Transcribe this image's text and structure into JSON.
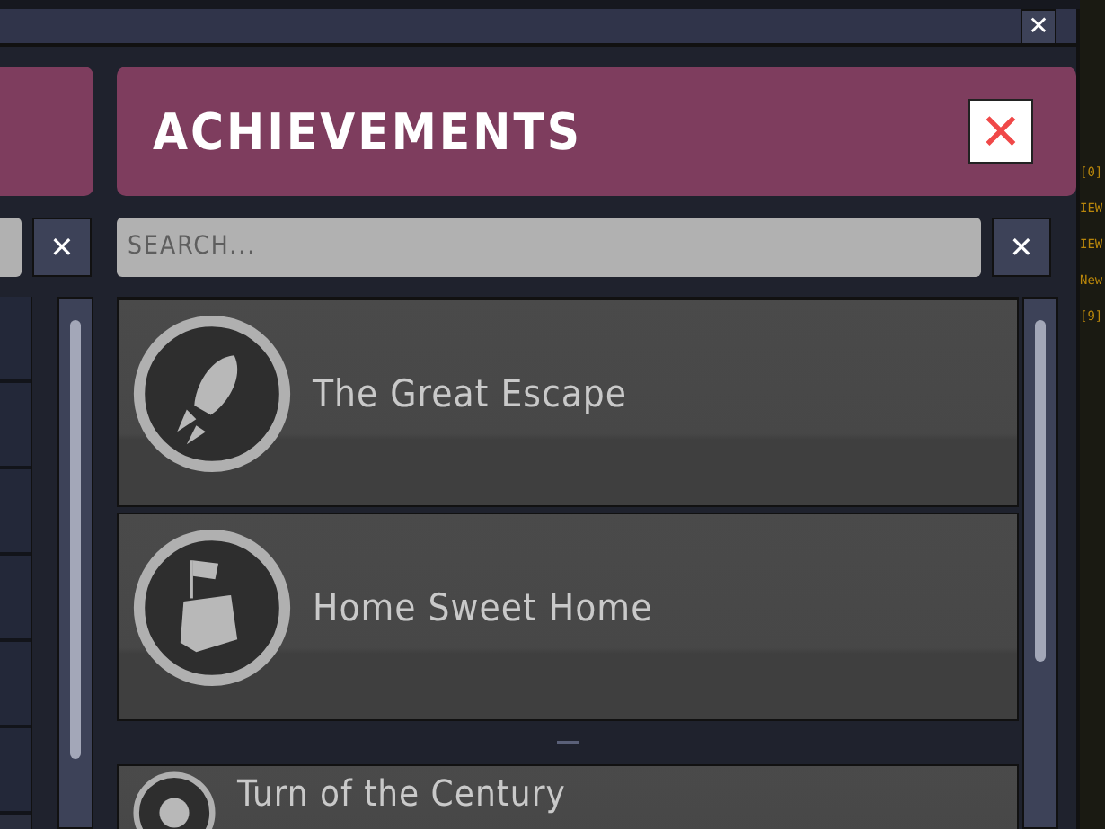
{
  "window": {
    "close_label": "✕"
  },
  "left_panel": {
    "clear_label": "✕"
  },
  "achievements_panel": {
    "title": "ACHIEVEMENTS",
    "close_label": "✕",
    "search": {
      "placeholder": "SEARCH..."
    },
    "clear_label": "✕",
    "items": [
      {
        "kind": "achievement",
        "name": "The Great Escape"
      },
      {
        "kind": "achievement",
        "name": "Home Sweet Home"
      },
      {
        "kind": "separator"
      },
      {
        "kind": "achievement",
        "name": "Turn of the Century"
      }
    ]
  },
  "background_labels": [
    "[0]",
    "IEW",
    "IEW",
    "New",
    "[9]"
  ]
}
